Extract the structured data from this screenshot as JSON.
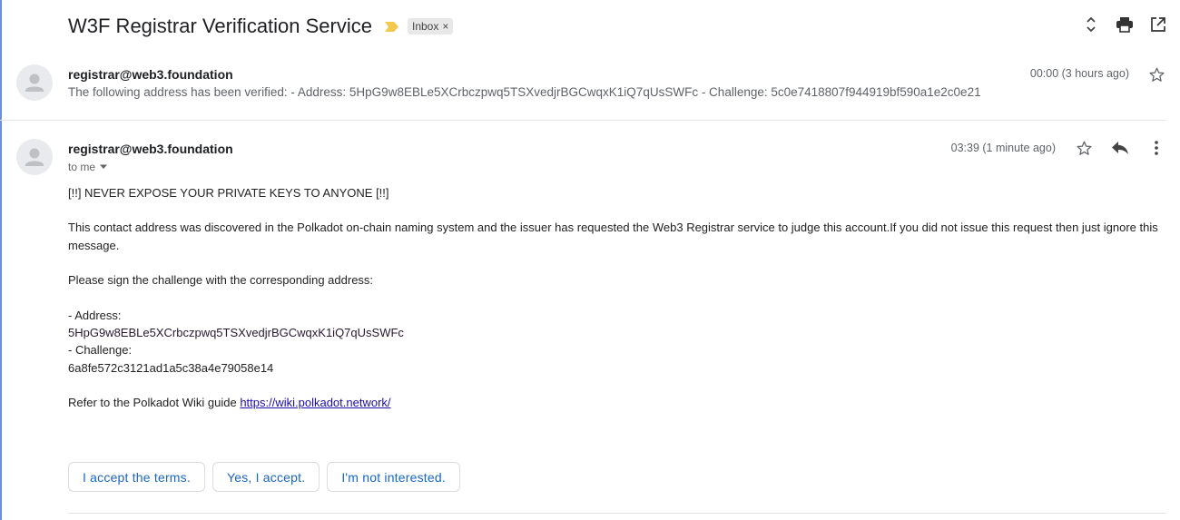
{
  "thread": {
    "subject": "W3F Registrar Verification Service",
    "label": "Inbox",
    "label_remove": "×"
  },
  "icons": {
    "importance": "importance-marker-icon",
    "expand": "expand-collapse-icon",
    "print": "print-icon",
    "new_window": "open-in-new-window-icon",
    "star": "star-icon",
    "reply": "reply-icon",
    "more": "more-vertical-icon",
    "avatar": "person-icon"
  },
  "colors": {
    "importance": "#f2c94c",
    "reply_chip_text": "#1a66c2",
    "link": "#1a0dab"
  },
  "message1": {
    "sender": "registrar@web3.foundation",
    "snippet": "The following address has been verified: - Address: 5HpG9w8EBLe5XCrbczpwq5TSXvedjrBGCwqxK1iQ7qUsSWFc - Challenge: 5c0e7418807f944919bf590a1e2c0e21",
    "time": "00:00 (3 hours ago)"
  },
  "message2": {
    "sender": "registrar@web3.foundation",
    "to": "to me",
    "time": "03:39 (1 minute ago)",
    "body": {
      "warning": "[!!] NEVER EXPOSE YOUR PRIVATE KEYS TO ANYONE [!!]",
      "intro": "This contact address was discovered in the Polkadot on-chain naming system and the issuer has requested the Web3 Registrar service to judge this account.If you did not issue this request then just ignore this message.",
      "sign_prompt": "Please sign the challenge with the corresponding address:",
      "address_label": "- Address:",
      "address": "5HpG9w8EBLe5XCrbczpwq5TSXvedjrBGCwqxK1iQ7qUsSWFc",
      "challenge_label": "- Challenge:",
      "challenge": "6a8fe572c3121ad1a5c38a4e79058e14",
      "refer_text": "Refer to the Polkadot Wiki guide ",
      "link": "https://wiki.polkadot.network/"
    }
  },
  "smart_replies": [
    "I accept the terms.",
    "Yes, I accept.",
    "I'm not interested."
  ]
}
